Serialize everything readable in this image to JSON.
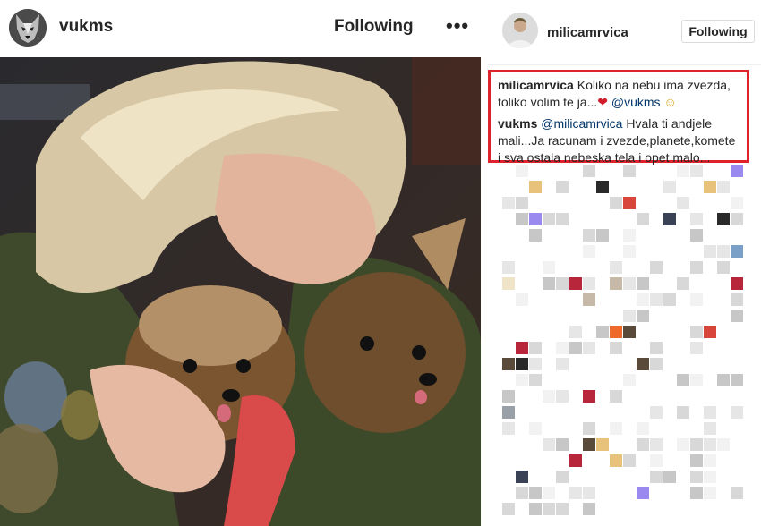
{
  "left_post": {
    "username": "vukms",
    "follow_state": "Following",
    "more_label": "•••"
  },
  "right_post": {
    "username": "milicamrvica",
    "follow_button": "Following"
  },
  "comments": [
    {
      "username": "milicamrvica",
      "text_before": "Koliko na nebu ima zvezda, toliko volim te ja...",
      "heart": "❤",
      "mention": "@vukms",
      "emoji": "☺"
    },
    {
      "username": "vukms",
      "mention": "@milicamrvica",
      "text_after": "Hvala ti andjele mali...Ja racunam i zvezde,planete,komete i sva ostala nebeska tela i opet malo..."
    }
  ],
  "colors": {
    "highlight_border": "#e0222c",
    "mention": "#003569",
    "text": "#262626"
  },
  "icons": {
    "more": "more-options-icon",
    "heart": "heart-icon",
    "emoji": "smile-emoji-icon"
  }
}
